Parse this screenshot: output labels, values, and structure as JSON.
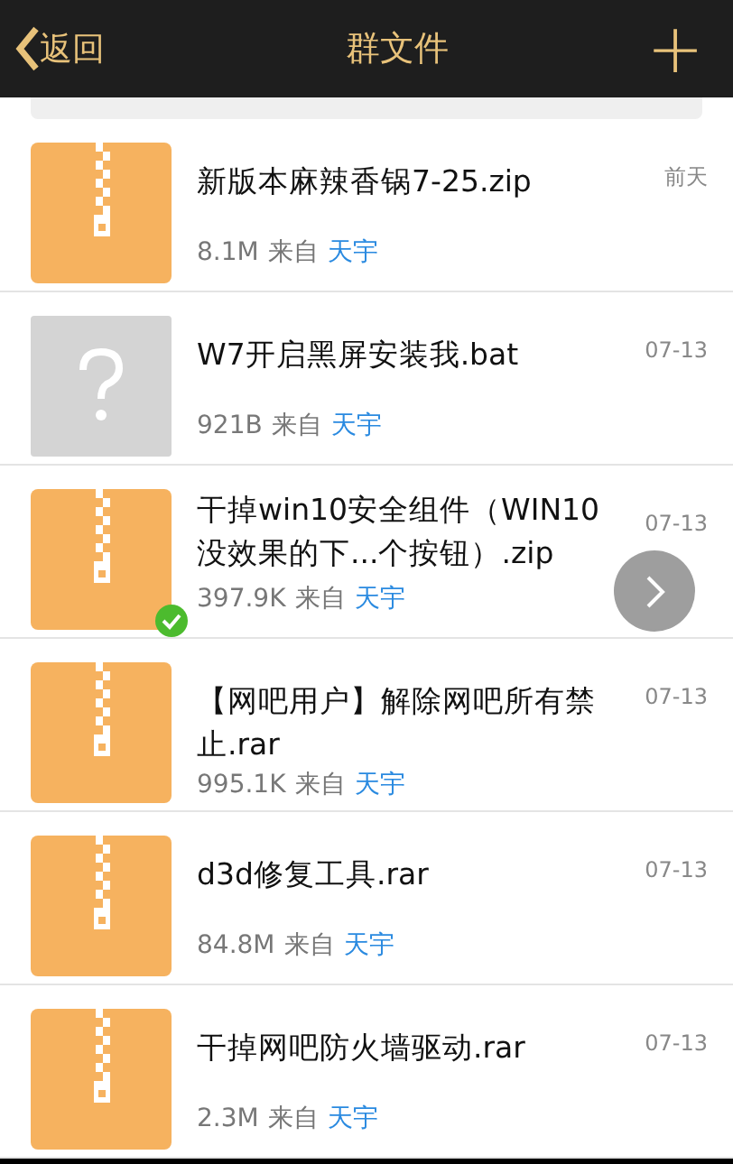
{
  "header": {
    "back_label": "返回",
    "title": "群文件",
    "add_label": "+"
  },
  "files": [
    {
      "kind": "archive",
      "name": "新版本麻辣香锅7-25.zip",
      "size": "8.1M",
      "from_label": "来自",
      "uploader": "天宇",
      "date": "前天",
      "downloaded": false
    },
    {
      "kind": "unknown",
      "name": "W7开启黑屏安装我.bat",
      "size": "921B",
      "from_label": "来自",
      "uploader": "天宇",
      "date": "07-13",
      "downloaded": false
    },
    {
      "kind": "archive",
      "name": "干掉win10安全组件（WIN10没效果的下...个按钮）.zip",
      "size": "397.9K",
      "from_label": "来自",
      "uploader": "天宇",
      "date": "07-13",
      "downloaded": true
    },
    {
      "kind": "archive",
      "name": "【网吧用户】解除网吧所有禁止.rar",
      "size": "995.1K",
      "from_label": "来自",
      "uploader": "天宇",
      "date": "07-13",
      "downloaded": false
    },
    {
      "kind": "archive",
      "name": "d3d修复工具.rar",
      "size": "84.8M",
      "from_label": "来自",
      "uploader": "天宇",
      "date": "07-13",
      "downloaded": false
    },
    {
      "kind": "archive",
      "name": "干掉网吧防火墙驱动.rar",
      "size": "2.3M",
      "from_label": "来自",
      "uploader": "天宇",
      "date": "07-13",
      "downloaded": false
    }
  ]
}
